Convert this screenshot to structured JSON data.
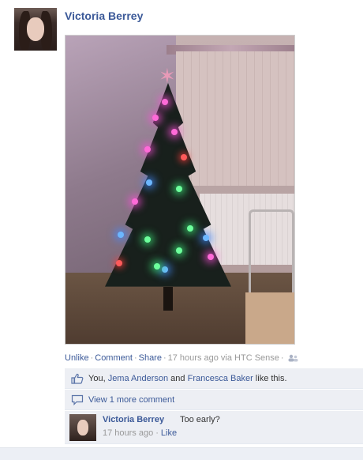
{
  "post": {
    "author": "Victoria Berrey",
    "photo_alt": "photo"
  },
  "actions": {
    "unlike": "Unlike",
    "comment": "Comment",
    "share": "Share",
    "timestamp": "17 hours ago via HTC Sense",
    "separator": "·"
  },
  "likes": {
    "prefix": "You, ",
    "person1": "Jema Anderson",
    "and": " and ",
    "person2": "Francesca Baker",
    "suffix": " like this."
  },
  "view_more": {
    "label": "View 1 more comment"
  },
  "comment": {
    "author": "Victoria Berrey",
    "text": "Too early?",
    "timestamp": "17 hours ago",
    "separator": "·",
    "like": "Like"
  },
  "icons": {
    "like": "thumbs-up-icon",
    "comment": "speech-bubble-icon",
    "audience": "friends-icon"
  },
  "colors": {
    "link": "#3b5998",
    "meta": "#999999",
    "ufi_bg": "#edeff4"
  }
}
